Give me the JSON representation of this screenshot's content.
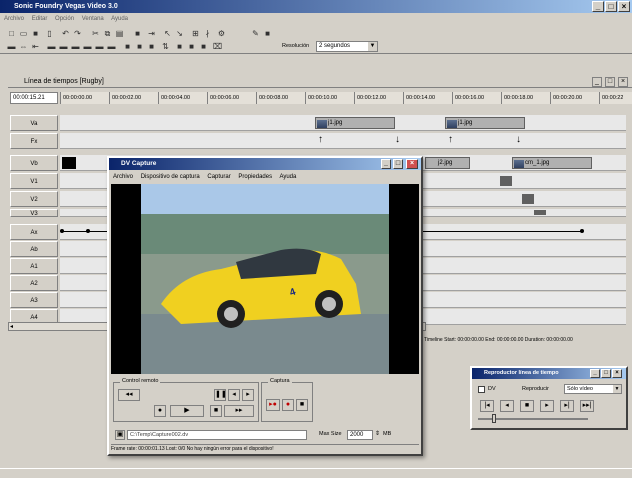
{
  "app": {
    "title": "Sonic Foundry Vegas Video 3.0",
    "menu": [
      "Archivo",
      "Editar",
      "Opción",
      "Ventana",
      "Ayuda"
    ]
  },
  "toolbar": {
    "resolution_label": "Resolución",
    "resolution_value": "2 segundos"
  },
  "timeline": {
    "title": "Línea de tiempos [Rugby]",
    "current_time": "00:00:15.21",
    "ruler": [
      "00:00:00.00",
      "00:00:02.00",
      "00:00:04.00",
      "00:00:06.00",
      "00:00:08.00",
      "00:00:10.00",
      "00:00:12.00",
      "00:00:14.00",
      "00:00:16.00",
      "00:00:18.00",
      "00:00:20.00",
      "00:00:22"
    ],
    "tracks": [
      "Va",
      "Fx",
      "Vb",
      "V1",
      "V2",
      "V3",
      "Ax",
      "Ab",
      "A1",
      "A2",
      "A3",
      "A4"
    ],
    "clips": {
      "va_clip": "j1.jpg",
      "va_clip2": "j1.jpg",
      "vb_clip": "j2.jpg",
      "vb_clip2": "j1.jpg",
      "vb_clip3": "cm_1.jpg"
    },
    "status": {
      "timeline_label": "Timeline",
      "start": "Start: 00:00:00.00",
      "end": "End: 00:00:00.00",
      "duration": "Duration: 00:00:00.00"
    }
  },
  "capture": {
    "title": "DV Capture",
    "menu": [
      "Archivo",
      "Dispositivo de captura",
      "Capturar",
      "Propiedades",
      "Ayuda"
    ],
    "control_group": "Control remoto",
    "capture_group": "Captura",
    "file_path": "C:\\Temp\\Capture002.dv",
    "file_size_label": "Max Size",
    "file_size_value": "2000",
    "file_size_unit": "MB",
    "status": "Frame rate: 00:00:01.13   Lost: 0/0   No hay ningún error para el dispositivo!"
  },
  "preview": {
    "title": "Reproductor línea de tiempo",
    "dv_label": "DV",
    "reproduce_label": "Reproducir",
    "reproduce_value": "Sólo vídeo"
  }
}
